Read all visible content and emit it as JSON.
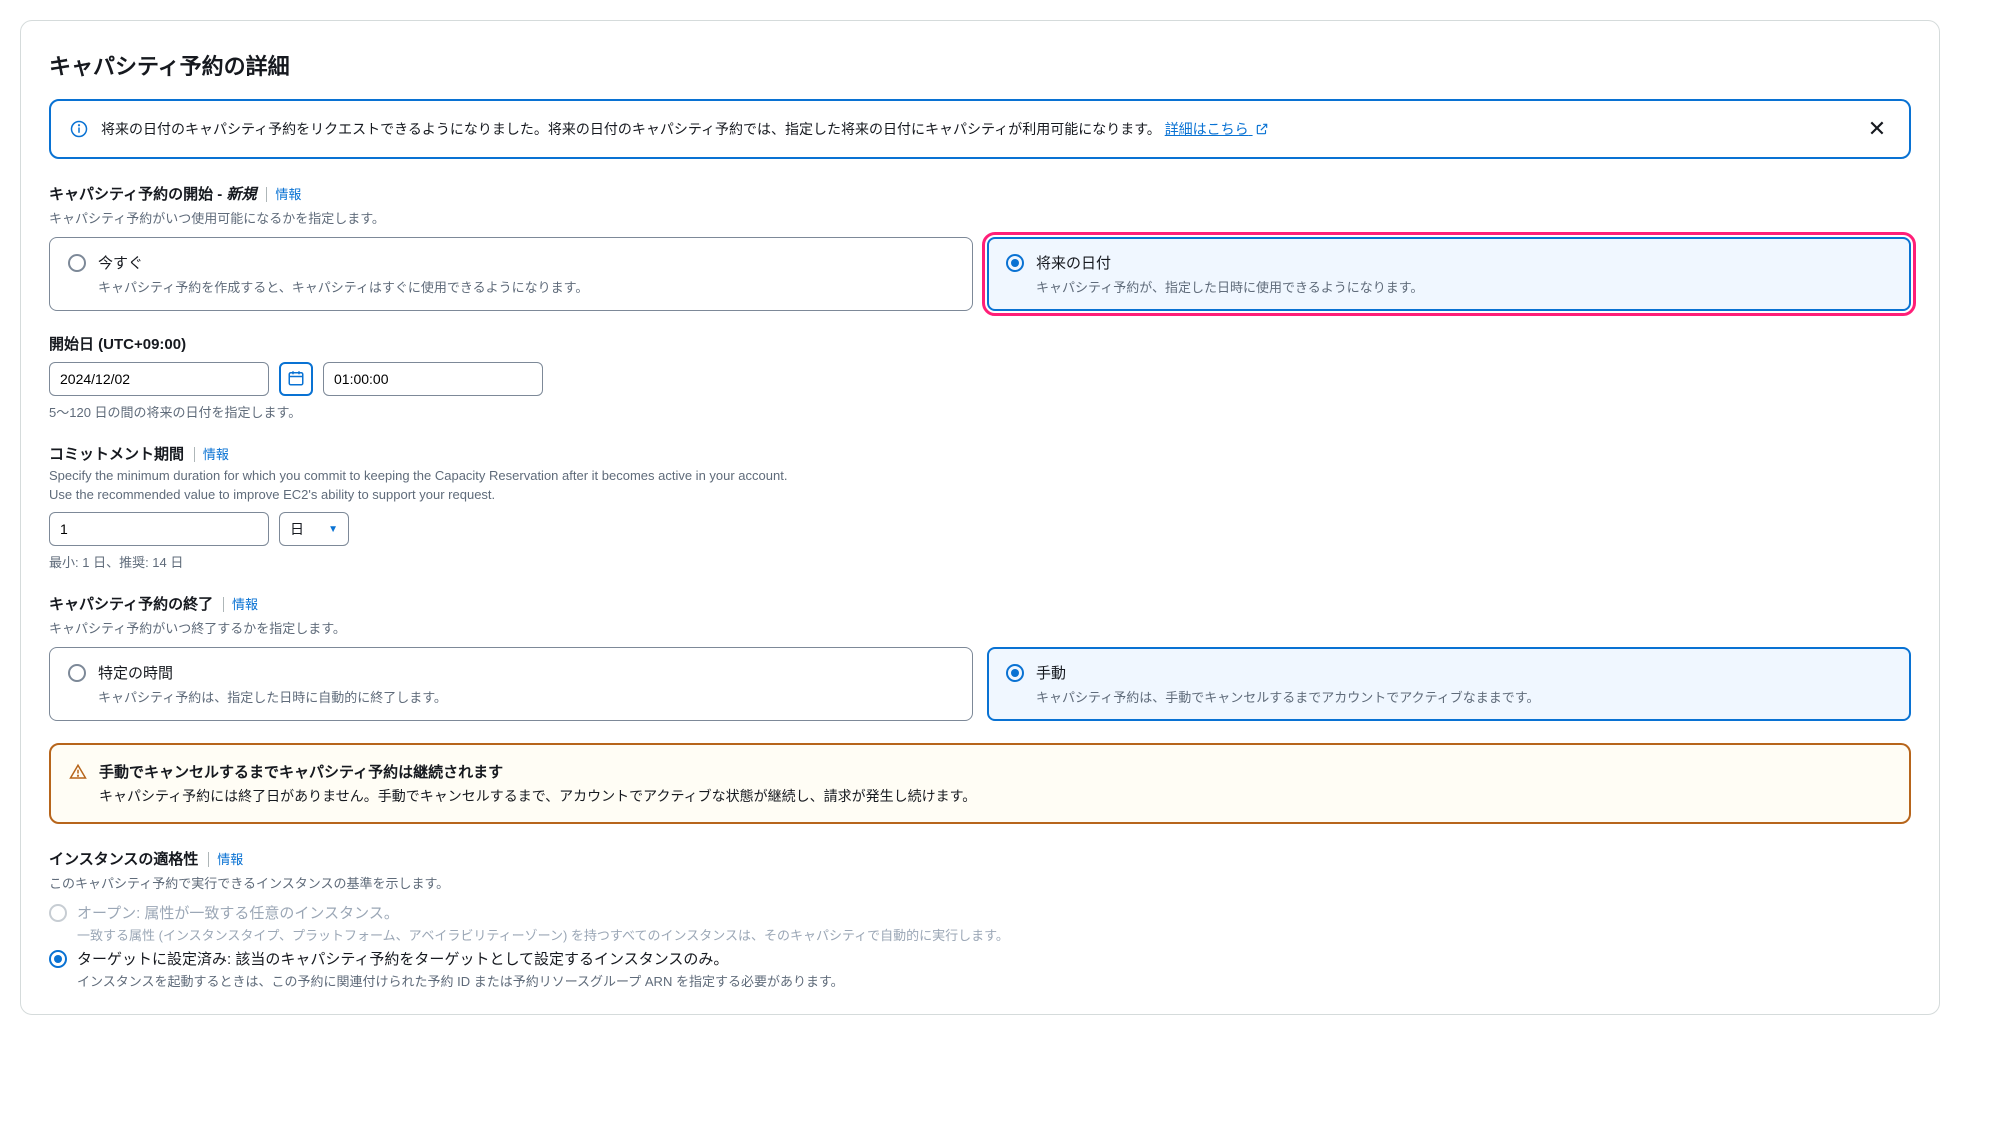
{
  "page": {
    "title": "キャパシティ予約の詳細"
  },
  "alert_info": {
    "text": "将来の日付のキャパシティ予約をリクエストできるようになりました。将来の日付のキャパシティ予約では、指定した将来の日付にキャパシティが利用可能になります。",
    "link_label": "詳細はこちら"
  },
  "start": {
    "heading": "キャパシティ予約の開始 - ",
    "new_tag": "新規",
    "info_label": "情報",
    "desc": "キャパシティ予約がいつ使用可能になるかを指定します。",
    "option_now": {
      "title": "今すぐ",
      "desc": "キャパシティ予約を作成すると、キャパシティはすぐに使用できるようになります。"
    },
    "option_future": {
      "title": "将来の日付",
      "desc": "キャパシティ予約が、指定した日時に使用できるようになります。"
    }
  },
  "start_date": {
    "heading": "開始日 (UTC+09:00)",
    "date_value": "2024/12/02",
    "time_value": "01:00:00",
    "hint": "5〜120 日の間の将来の日付を指定します。"
  },
  "commitment": {
    "heading": "コミットメント期間",
    "info_label": "情報",
    "desc_line1": "Specify the minimum duration for which you commit to keeping the Capacity Reservation after it becomes active in your account.",
    "desc_line2": "Use the recommended value to improve EC2's ability to support your request.",
    "value": "1",
    "unit": "日",
    "hint": "最小: 1 日、推奨: 14 日"
  },
  "end": {
    "heading": "キャパシティ予約の終了",
    "info_label": "情報",
    "desc": "キャパシティ予約がいつ終了するかを指定します。",
    "option_time": {
      "title": "特定の時間",
      "desc": "キャパシティ予約は、指定した日時に自動的に終了します。"
    },
    "option_manual": {
      "title": "手動",
      "desc": "キャパシティ予約は、手動でキャンセルするまでアカウントでアクティブなままです。"
    }
  },
  "warn": {
    "title": "手動でキャンセルするまでキャパシティ予約は継続されます",
    "desc": "キャパシティ予約には終了日がありません。手動でキャンセルするまで、アカウントでアクティブな状態が継続し、請求が発生し続けます。"
  },
  "eligibility": {
    "heading": "インスタンスの適格性",
    "info_label": "情報",
    "desc": "このキャパシティ予約で実行できるインスタンスの基準を示します。",
    "option_open": {
      "title": "オープン: 属性が一致する任意のインスタンス。",
      "desc": "一致する属性 (インスタンスタイプ、プラットフォーム、アベイラビリティーゾーン) を持つすべてのインスタンスは、そのキャパシティで自動的に実行します。"
    },
    "option_target": {
      "title": "ターゲットに設定済み: 該当のキャパシティ予約をターゲットとして設定するインスタンスのみ。",
      "desc": "インスタンスを起動するときは、この予約に関連付けられた予約 ID または予約リソースグループ ARN を指定する必要があります。"
    }
  }
}
